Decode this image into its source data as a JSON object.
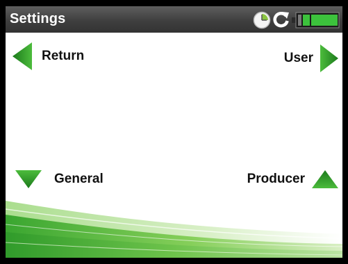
{
  "header": {
    "title": "Settings",
    "status_icons": [
      "clock-icon",
      "sync-icon",
      "battery-icon"
    ]
  },
  "nav": {
    "return_label": "Return",
    "user_label": "User",
    "general_label": "General",
    "producer_label": "Producer"
  },
  "colors": {
    "accent_green": "#2f9a2a",
    "titlebar": "#4a4a4a",
    "battery": "#3cc23c"
  }
}
